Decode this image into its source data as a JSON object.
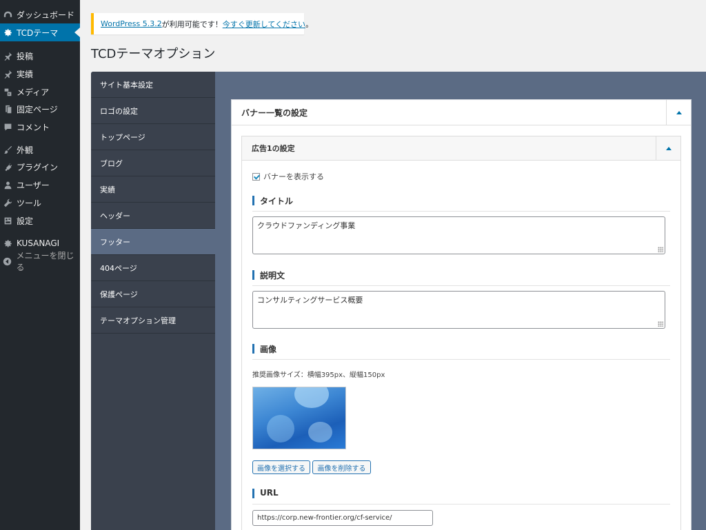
{
  "admin_menu": {
    "items": [
      {
        "label": "ダッシュボード",
        "icon": "dashboard-icon"
      },
      {
        "label": "TCDテーマ",
        "icon": "gear-icon",
        "current": true
      },
      {
        "label": "投稿",
        "icon": "pin-icon"
      },
      {
        "label": "実績",
        "icon": "pin-icon"
      },
      {
        "label": "メディア",
        "icon": "media-icon"
      },
      {
        "label": "固定ページ",
        "icon": "page-icon"
      },
      {
        "label": "コメント",
        "icon": "comment-icon"
      },
      {
        "label": "外観",
        "icon": "brush-icon"
      },
      {
        "label": "プラグイン",
        "icon": "plugin-icon"
      },
      {
        "label": "ユーザー",
        "icon": "user-icon"
      },
      {
        "label": "ツール",
        "icon": "wrench-icon"
      },
      {
        "label": "設定",
        "icon": "settings-icon"
      },
      {
        "label": "KUSANAGI",
        "icon": "gear-icon"
      },
      {
        "label": "メニューを閉じる",
        "icon": "collapse-icon"
      }
    ]
  },
  "notice": {
    "link1": "WordPress 5.3.2",
    "middle": " が利用可能です！",
    "link2": "今すぐ更新してください",
    "end": "。"
  },
  "page_title": "TCDテーマオプション",
  "tabs": [
    {
      "label": "サイト基本設定"
    },
    {
      "label": "ロゴの設定"
    },
    {
      "label": "トップページ"
    },
    {
      "label": "ブログ"
    },
    {
      "label": "実績"
    },
    {
      "label": "ヘッダー"
    },
    {
      "label": "フッター",
      "active": true
    },
    {
      "label": "404ページ"
    },
    {
      "label": "保護ページ"
    },
    {
      "label": "テーマオプション管理"
    }
  ],
  "section": {
    "title": "バナー一覧の設定",
    "sub_title": "広告1の設定",
    "show_banner_label": "バナーを表示する",
    "show_banner_checked": true,
    "title_heading": "タイトル",
    "title_value": "クラウドファンディング事業",
    "desc_heading": "説明文",
    "desc_value": "コンサルティングサービス概要",
    "image_heading": "画像",
    "image_hint": "推奨画像サイズ：横幅395px、縦幅150px",
    "select_image_button": "画像を選択する",
    "remove_image_button": "画像を削除する",
    "url_heading": "URL",
    "url_value": "https://corp.new-frontier.org/cf-service/"
  },
  "colors": {
    "accent": "#0073aa",
    "panel": "#5b6b84",
    "tabs_bg": "#3a414d",
    "admin_menu_bg": "#23282d"
  }
}
